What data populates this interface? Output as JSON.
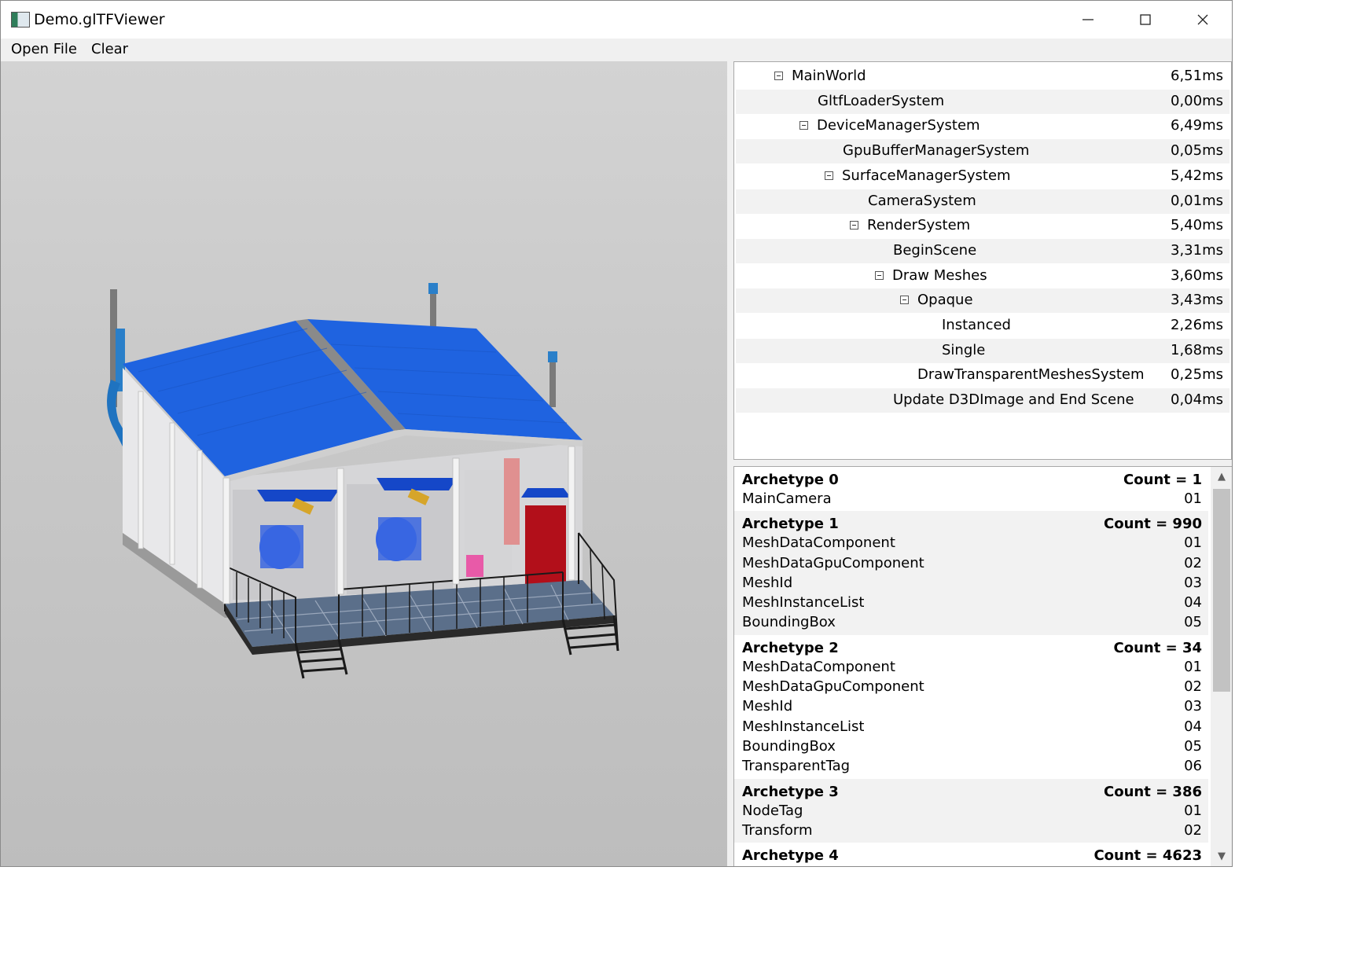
{
  "window": {
    "title": "Demo.glTFViewer",
    "minimize_icon": "minimize-icon",
    "maximize_icon": "maximize-icon",
    "close_icon": "close-icon"
  },
  "menu": {
    "items": [
      {
        "label": "Open File"
      },
      {
        "label": "Clear"
      }
    ]
  },
  "tree": {
    "rows": [
      {
        "name": "MainWorld",
        "time": "6,51ms",
        "expanded": true
      },
      {
        "name": "GltfLoaderSystem",
        "time": "0,00ms",
        "expanded": false
      },
      {
        "name": "DeviceManagerSystem",
        "time": "6,49ms",
        "expanded": true
      },
      {
        "name": "GpuBufferManagerSystem",
        "time": "0,05ms",
        "expanded": false
      },
      {
        "name": "SurfaceManagerSystem",
        "time": "5,42ms",
        "expanded": true
      },
      {
        "name": "CameraSystem",
        "time": "0,01ms",
        "expanded": false
      },
      {
        "name": "RenderSystem",
        "time": "5,40ms",
        "expanded": true
      },
      {
        "name": "BeginScene",
        "time": "3,31ms",
        "expanded": false
      },
      {
        "name": "Draw Meshes",
        "time": "3,60ms",
        "expanded": true
      },
      {
        "name": "Opaque",
        "time": "3,43ms",
        "expanded": true
      },
      {
        "name": "Instanced",
        "time": "2,26ms",
        "expanded": false
      },
      {
        "name": "Single",
        "time": "1,68ms",
        "expanded": false
      },
      {
        "name": "DrawTransparentMeshesSystem",
        "time": "0,25ms",
        "expanded": false
      },
      {
        "name": "Update D3DImage and End Scene",
        "time": "0,04ms",
        "expanded": false
      }
    ]
  },
  "archetypes": [
    {
      "name": "Archetype 0",
      "count": "Count = 1",
      "components": [
        {
          "name": "MainCamera",
          "id": "01"
        }
      ]
    },
    {
      "name": "Archetype 1",
      "count": "Count = 990",
      "components": [
        {
          "name": "MeshDataComponent",
          "id": "01"
        },
        {
          "name": "MeshDataGpuComponent",
          "id": "02"
        },
        {
          "name": "MeshId",
          "id": "03"
        },
        {
          "name": "MeshInstanceList",
          "id": "04"
        },
        {
          "name": "BoundingBox",
          "id": "05"
        }
      ]
    },
    {
      "name": "Archetype 2",
      "count": "Count = 34",
      "components": [
        {
          "name": "MeshDataComponent",
          "id": "01"
        },
        {
          "name": "MeshDataGpuComponent",
          "id": "02"
        },
        {
          "name": "MeshId",
          "id": "03"
        },
        {
          "name": "MeshInstanceList",
          "id": "04"
        },
        {
          "name": "BoundingBox",
          "id": "05"
        },
        {
          "name": "TransparentTag",
          "id": "06"
        }
      ]
    },
    {
      "name": "Archetype 3",
      "count": "Count = 386",
      "components": [
        {
          "name": "NodeTag",
          "id": "01"
        },
        {
          "name": "Transform",
          "id": "02"
        }
      ]
    },
    {
      "name": "Archetype 4",
      "count": "Count = 4623",
      "components": []
    }
  ],
  "viewport": {
    "scene": "3d-building-model",
    "roof_color": "#1f63e0",
    "door_color": "#b20f1a",
    "equipment_color": "#3463e6"
  }
}
